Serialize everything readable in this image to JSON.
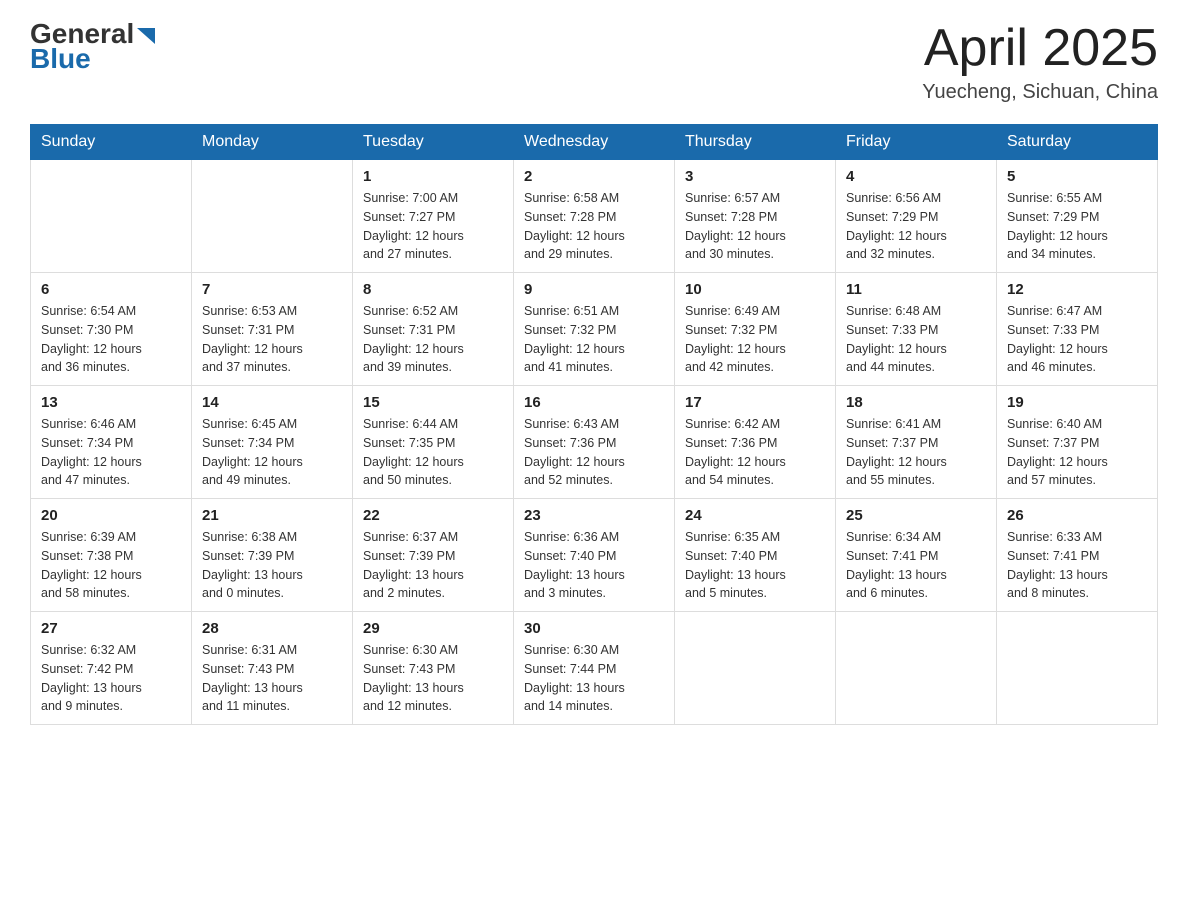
{
  "header": {
    "logo": {
      "general": "General",
      "blue": "Blue"
    },
    "title": "April 2025",
    "location": "Yuecheng, Sichuan, China"
  },
  "weekdays": [
    "Sunday",
    "Monday",
    "Tuesday",
    "Wednesday",
    "Thursday",
    "Friday",
    "Saturday"
  ],
  "weeks": [
    [
      {
        "day": "",
        "info": ""
      },
      {
        "day": "",
        "info": ""
      },
      {
        "day": "1",
        "info": "Sunrise: 7:00 AM\nSunset: 7:27 PM\nDaylight: 12 hours\nand 27 minutes."
      },
      {
        "day": "2",
        "info": "Sunrise: 6:58 AM\nSunset: 7:28 PM\nDaylight: 12 hours\nand 29 minutes."
      },
      {
        "day": "3",
        "info": "Sunrise: 6:57 AM\nSunset: 7:28 PM\nDaylight: 12 hours\nand 30 minutes."
      },
      {
        "day": "4",
        "info": "Sunrise: 6:56 AM\nSunset: 7:29 PM\nDaylight: 12 hours\nand 32 minutes."
      },
      {
        "day": "5",
        "info": "Sunrise: 6:55 AM\nSunset: 7:29 PM\nDaylight: 12 hours\nand 34 minutes."
      }
    ],
    [
      {
        "day": "6",
        "info": "Sunrise: 6:54 AM\nSunset: 7:30 PM\nDaylight: 12 hours\nand 36 minutes."
      },
      {
        "day": "7",
        "info": "Sunrise: 6:53 AM\nSunset: 7:31 PM\nDaylight: 12 hours\nand 37 minutes."
      },
      {
        "day": "8",
        "info": "Sunrise: 6:52 AM\nSunset: 7:31 PM\nDaylight: 12 hours\nand 39 minutes."
      },
      {
        "day": "9",
        "info": "Sunrise: 6:51 AM\nSunset: 7:32 PM\nDaylight: 12 hours\nand 41 minutes."
      },
      {
        "day": "10",
        "info": "Sunrise: 6:49 AM\nSunset: 7:32 PM\nDaylight: 12 hours\nand 42 minutes."
      },
      {
        "day": "11",
        "info": "Sunrise: 6:48 AM\nSunset: 7:33 PM\nDaylight: 12 hours\nand 44 minutes."
      },
      {
        "day": "12",
        "info": "Sunrise: 6:47 AM\nSunset: 7:33 PM\nDaylight: 12 hours\nand 46 minutes."
      }
    ],
    [
      {
        "day": "13",
        "info": "Sunrise: 6:46 AM\nSunset: 7:34 PM\nDaylight: 12 hours\nand 47 minutes."
      },
      {
        "day": "14",
        "info": "Sunrise: 6:45 AM\nSunset: 7:34 PM\nDaylight: 12 hours\nand 49 minutes."
      },
      {
        "day": "15",
        "info": "Sunrise: 6:44 AM\nSunset: 7:35 PM\nDaylight: 12 hours\nand 50 minutes."
      },
      {
        "day": "16",
        "info": "Sunrise: 6:43 AM\nSunset: 7:36 PM\nDaylight: 12 hours\nand 52 minutes."
      },
      {
        "day": "17",
        "info": "Sunrise: 6:42 AM\nSunset: 7:36 PM\nDaylight: 12 hours\nand 54 minutes."
      },
      {
        "day": "18",
        "info": "Sunrise: 6:41 AM\nSunset: 7:37 PM\nDaylight: 12 hours\nand 55 minutes."
      },
      {
        "day": "19",
        "info": "Sunrise: 6:40 AM\nSunset: 7:37 PM\nDaylight: 12 hours\nand 57 minutes."
      }
    ],
    [
      {
        "day": "20",
        "info": "Sunrise: 6:39 AM\nSunset: 7:38 PM\nDaylight: 12 hours\nand 58 minutes."
      },
      {
        "day": "21",
        "info": "Sunrise: 6:38 AM\nSunset: 7:39 PM\nDaylight: 13 hours\nand 0 minutes."
      },
      {
        "day": "22",
        "info": "Sunrise: 6:37 AM\nSunset: 7:39 PM\nDaylight: 13 hours\nand 2 minutes."
      },
      {
        "day": "23",
        "info": "Sunrise: 6:36 AM\nSunset: 7:40 PM\nDaylight: 13 hours\nand 3 minutes."
      },
      {
        "day": "24",
        "info": "Sunrise: 6:35 AM\nSunset: 7:40 PM\nDaylight: 13 hours\nand 5 minutes."
      },
      {
        "day": "25",
        "info": "Sunrise: 6:34 AM\nSunset: 7:41 PM\nDaylight: 13 hours\nand 6 minutes."
      },
      {
        "day": "26",
        "info": "Sunrise: 6:33 AM\nSunset: 7:41 PM\nDaylight: 13 hours\nand 8 minutes."
      }
    ],
    [
      {
        "day": "27",
        "info": "Sunrise: 6:32 AM\nSunset: 7:42 PM\nDaylight: 13 hours\nand 9 minutes."
      },
      {
        "day": "28",
        "info": "Sunrise: 6:31 AM\nSunset: 7:43 PM\nDaylight: 13 hours\nand 11 minutes."
      },
      {
        "day": "29",
        "info": "Sunrise: 6:30 AM\nSunset: 7:43 PM\nDaylight: 13 hours\nand 12 minutes."
      },
      {
        "day": "30",
        "info": "Sunrise: 6:30 AM\nSunset: 7:44 PM\nDaylight: 13 hours\nand 14 minutes."
      },
      {
        "day": "",
        "info": ""
      },
      {
        "day": "",
        "info": ""
      },
      {
        "day": "",
        "info": ""
      }
    ]
  ]
}
